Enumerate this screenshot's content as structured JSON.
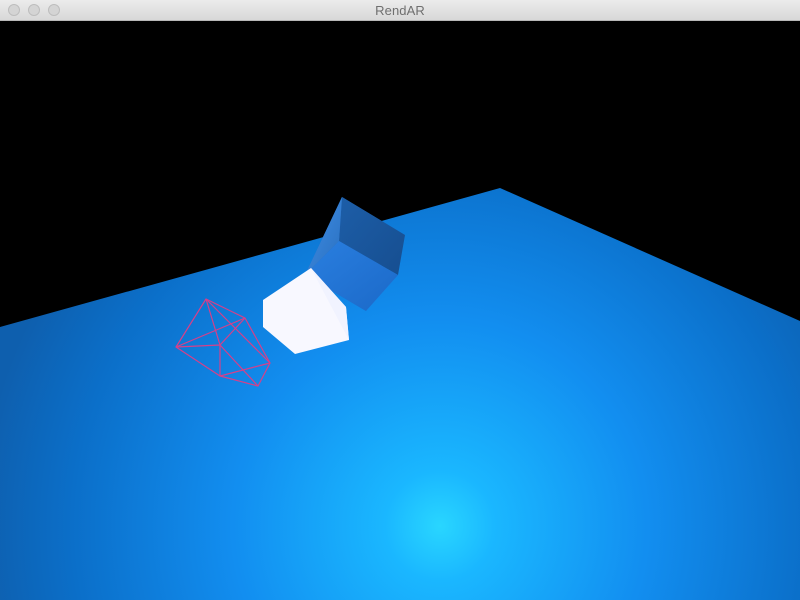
{
  "window": {
    "title": "RendAR"
  },
  "titlebar": {
    "buttons": [
      {
        "name": "close",
        "color": "#d4d4d4"
      },
      {
        "name": "minimize",
        "color": "#d4d4d4"
      },
      {
        "name": "maximize",
        "color": "#d4d4d4"
      }
    ]
  },
  "scene": {
    "background_color": "#000000",
    "ground_plane_color": "#1a7fe0",
    "highlight_color": "#29d6ff",
    "solid_cubes": [
      {
        "name": "blue-cube",
        "color": "#2f7fd9"
      },
      {
        "name": "white-cube",
        "color": "#f8f8ff"
      }
    ],
    "wireframe_cubes": [
      {
        "name": "red-wireframe-cube",
        "color": "#d6408a"
      }
    ]
  }
}
